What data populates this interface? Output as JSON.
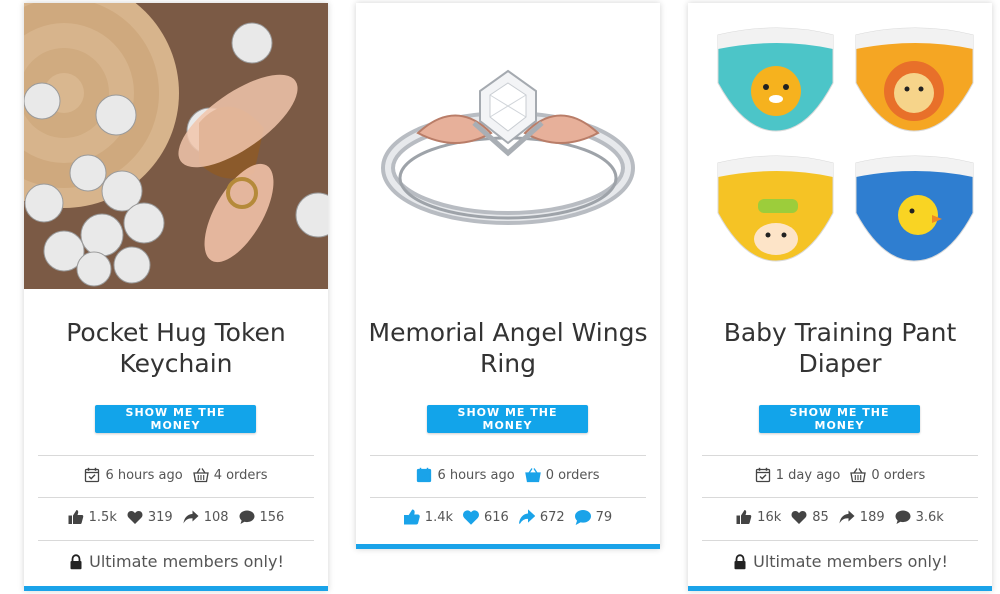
{
  "cards": [
    {
      "title": "Pocket Hug Token Keychain",
      "cta": "SHOW ME THE MONEY",
      "time": "6 hours ago",
      "orders": "4 orders",
      "likes": "1.5k",
      "hearts": "319",
      "shares": "108",
      "comments": "156",
      "restriction": "Ultimate members only!"
    },
    {
      "title": "Memorial Angel Wings Ring",
      "cta": "SHOW ME THE MONEY",
      "time": "6 hours ago",
      "orders": "0 orders",
      "likes": "1.4k",
      "hearts": "616",
      "shares": "672",
      "comments": "79"
    },
    {
      "title": "Baby Training Pant Diaper",
      "cta": "SHOW ME THE MONEY",
      "time": "1 day ago",
      "orders": "0 orders",
      "likes": "16k",
      "hearts": "85",
      "shares": "189",
      "comments": "3.6k",
      "restriction": "Ultimate members only!"
    }
  ],
  "colors": {
    "accent": "#1aa3e9",
    "text": "#333333",
    "muted": "#555555"
  },
  "icons": [
    "calendar-icon",
    "basket-icon",
    "thumbs-up-icon",
    "heart-icon",
    "share-icon",
    "comment-icon",
    "lock-icon"
  ]
}
